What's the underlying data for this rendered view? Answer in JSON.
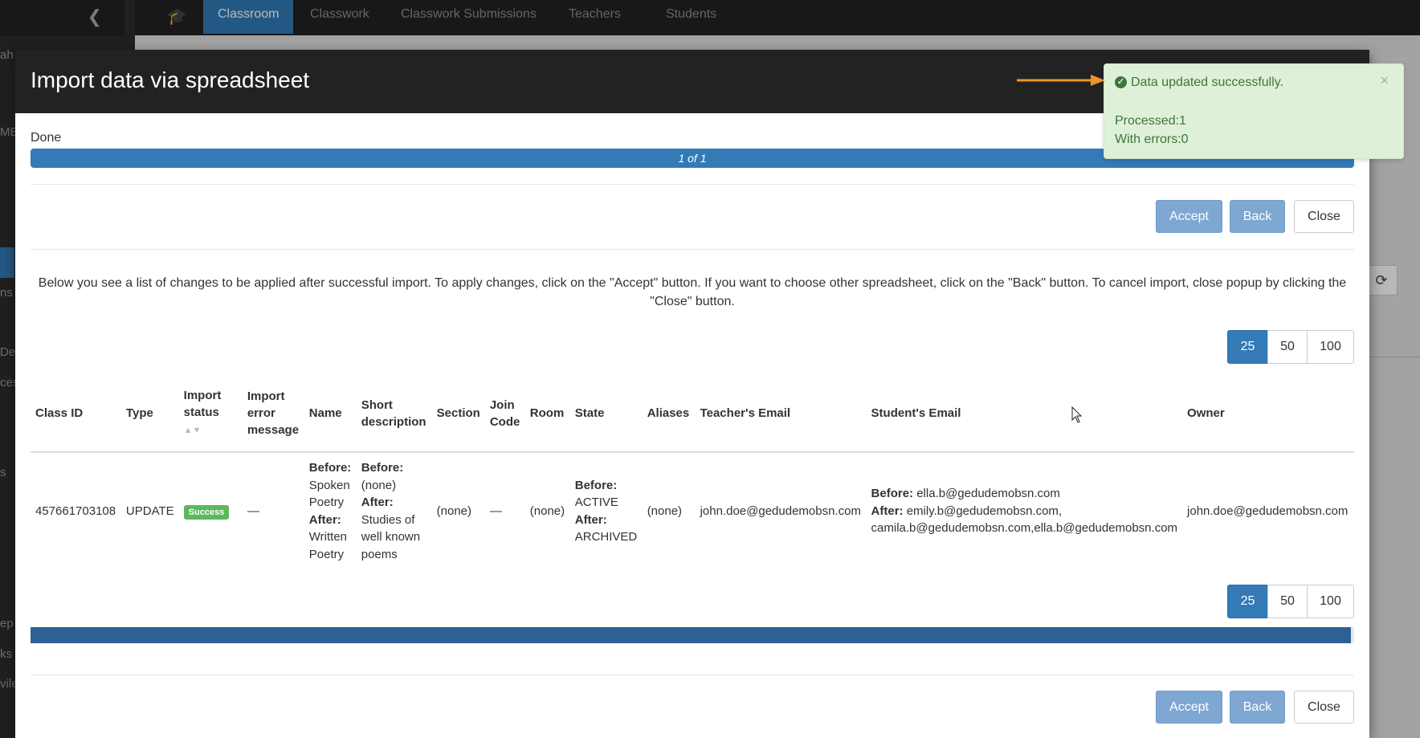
{
  "background": {
    "nav_tabs": [
      "Classroom",
      "Classwork",
      "Classwork Submissions",
      "Teachers",
      "Students"
    ],
    "active_tab": "Classroom",
    "sidebar_fragments": [
      "ah",
      "ME",
      "ns",
      "De",
      "ces",
      "s",
      "ep",
      "ks",
      "vile"
    ]
  },
  "modal": {
    "title": "Import data via spreadsheet",
    "status_label": "Done",
    "progress": {
      "text": "1 of 1",
      "fraction": 1.0
    },
    "buttons": {
      "accept": "Accept",
      "back": "Back",
      "close": "Close"
    },
    "info_text": "Below you see a list of changes to be applied after successful import. To apply changes, click on the \"Accept\" button. If you want to choose other spreadsheet, click on the \"Back\" button. To cancel import, close popup by clicking the \"Close\" button.",
    "page_sizes": [
      "25",
      "50",
      "100"
    ],
    "selected_page_size": "25",
    "table": {
      "columns": {
        "class_id": "Class ID",
        "type": "Type",
        "import_status": "Import status",
        "import_error": "Import error message",
        "name": "Name",
        "short_description": "Short description",
        "section": "Section",
        "join_code": "Join Code",
        "room": "Room",
        "state": "State",
        "aliases": "Aliases",
        "teacher_email": "Teacher's Email",
        "student_email": "Student's Email",
        "owner": "Owner"
      },
      "labels": {
        "before": "Before:",
        "after": "After:"
      },
      "row": {
        "class_id": "457661703108",
        "type": "UPDATE",
        "import_status": "Success",
        "import_error": "—",
        "name_before": "Spoken Poetry",
        "name_after": "Written Poetry",
        "desc_before": "(none)",
        "desc_after": "Studies of well known poems",
        "section": "(none)",
        "join_code": "—",
        "room": "(none)",
        "state_before": "ACTIVE",
        "state_after": "ARCHIVED",
        "aliases": "(none)",
        "teacher_email": "john.doe@gedudemobsn.com",
        "student_before": "ella.b@gedudemobsn.com",
        "student_after_1": "emily.b@gedudemobsn.com,",
        "student_after_2": "camila.b@gedudemobsn.com,ella.b@gedudemobsn.com",
        "owner": "john.doe@gedudemobsn.com"
      }
    }
  },
  "toast": {
    "message": "Data updated successfully.",
    "processed": "Processed:1",
    "errors": "With errors:0",
    "close": "×"
  },
  "colors": {
    "primary": "#337ab7",
    "success_bg": "#dff0d8",
    "success_text": "#3c763d",
    "arrow": "#f0922b"
  }
}
